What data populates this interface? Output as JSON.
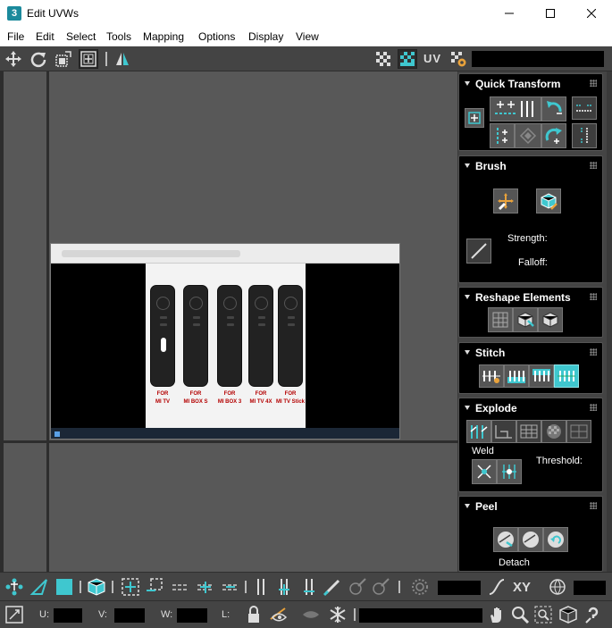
{
  "window": {
    "app_badge": "3",
    "title": "Edit UVWs",
    "buttons": [
      "minimize-icon",
      "maximize-icon",
      "close-icon"
    ]
  },
  "menubar": {
    "items": [
      "File",
      "Edit",
      "Select",
      "Tools",
      "Mapping",
      "Options",
      "Display",
      "View"
    ]
  },
  "toolbar": {
    "uv_label": "UV",
    "icons": [
      "move-icon",
      "rotate-icon",
      "scale-icon",
      "freeform-icon",
      "mirror-icon",
      "checker-icon",
      "texture-toggle-icon",
      "uv-settings-icon"
    ]
  },
  "viewport": {
    "texture": {
      "remote_labels": [
        [
          "FOR",
          "MI TV"
        ],
        [
          "FOR",
          "MI BOX S"
        ],
        [
          "FOR",
          "MI BOX 3"
        ],
        [
          "FOR",
          "MI TV 4X"
        ],
        [
          "FOR",
          "MI TV Stick"
        ]
      ]
    }
  },
  "panel": {
    "rollouts": {
      "quick_transform": "Quick Transform",
      "brush": "Brush",
      "reshape": "Reshape Elements",
      "stitch": "Stitch",
      "explode": "Explode",
      "peel": "Peel"
    },
    "brush_labels": {
      "strength": "Strength:",
      "falloff": "Falloff:"
    },
    "explode_labels": {
      "weld": "Weld",
      "threshold": "Threshold:"
    },
    "peel_labels": {
      "detach": "Detach"
    },
    "accent_color": "#3fc7cf"
  },
  "statusbar": {
    "xy_label": "XY",
    "u_label": "U:",
    "v_label": "V:",
    "w_label": "W:",
    "l_label": "L:"
  }
}
